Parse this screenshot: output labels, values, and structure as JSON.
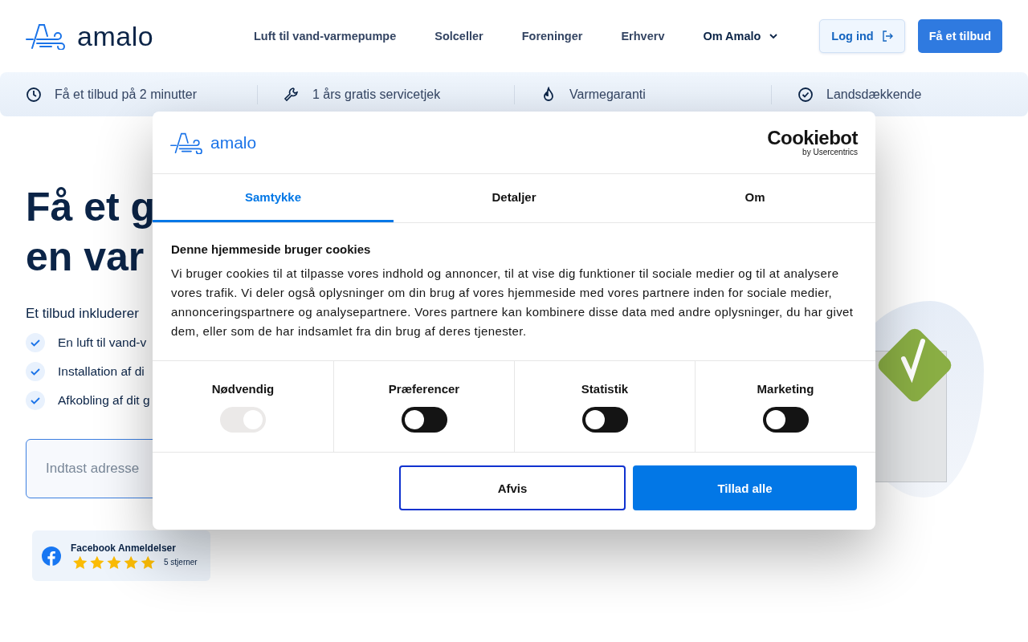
{
  "header": {
    "logo_text": "amalo",
    "nav": [
      {
        "label": "Luft til vand-varmepumpe",
        "has_menu": false
      },
      {
        "label": "Solceller",
        "has_menu": false
      },
      {
        "label": "Foreninger",
        "has_menu": false
      },
      {
        "label": "Erhverv",
        "has_menu": false
      },
      {
        "label": "Om Amalo",
        "has_menu": true
      }
    ],
    "login": "Log ind",
    "cta": "Få et tilbud"
  },
  "features": [
    "Få et tilbud på 2 minutter",
    "1 års gratis servicetjek",
    "Varmegaranti",
    "Landsdækkende"
  ],
  "hero": {
    "title_lines": [
      "Få et g",
      "en var"
    ],
    "intro": "Et tilbud inkluderer",
    "bullets": [
      "En luft til vand-v",
      "Installation af di",
      "Afkobling af dit g"
    ],
    "address": {
      "placeholder": "Indtast adresse"
    }
  },
  "review": {
    "title": "Facebook Anmeldelser",
    "stars": 5,
    "caption": "5 stjerner"
  },
  "cookie_dialog": {
    "logo_text": "amalo",
    "brand": "Cookiebot",
    "brand_sub": "by Usercentrics",
    "tabs": [
      {
        "label": "Samtykke",
        "selected": true
      },
      {
        "label": "Detaljer",
        "selected": false
      },
      {
        "label": "Om",
        "selected": false
      }
    ],
    "heading": "Denne hjemmeside bruger cookies",
    "body": "Vi bruger cookies til at tilpasse vores indhold og annoncer, til at vise dig funktioner til sociale medier og til at analysere vores trafik. Vi deler også oplysninger om din brug af vores hjemmeside med vores partnere inden for sociale medier, annonceringspartnere og analysepartnere. Vores partnere kan kombinere disse data med andre oplysninger, du har givet dem, eller som de har indsamlet fra din brug af deres tjenester.",
    "consents": [
      {
        "label": "Nødvendig",
        "checked": true,
        "disabled": true
      },
      {
        "label": "Præferencer",
        "checked": false,
        "disabled": false
      },
      {
        "label": "Statistik",
        "checked": false,
        "disabled": false
      },
      {
        "label": "Marketing",
        "checked": false,
        "disabled": false
      }
    ],
    "buttons": [
      {
        "label": "Afvis",
        "kind": "outline"
      },
      {
        "label": "Tillad alle",
        "kind": "primary"
      }
    ]
  }
}
